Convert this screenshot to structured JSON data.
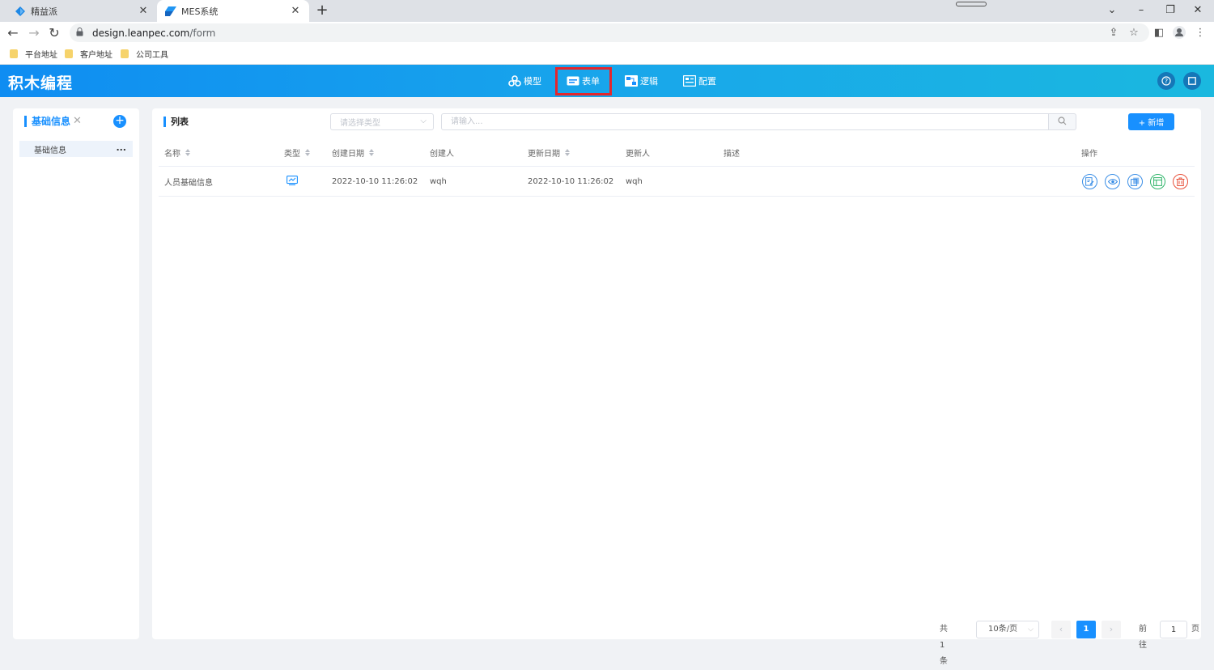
{
  "browser": {
    "tabs": [
      {
        "title": "精益派",
        "favicon": "diamond-icon",
        "active": false
      },
      {
        "title": "MES系统",
        "favicon": "diamond-icon",
        "active": true
      }
    ],
    "url_host": "design.leanpec.com",
    "url_path": "/form",
    "bookmarks": [
      "平台地址",
      "客户地址",
      "公司工具"
    ]
  },
  "app": {
    "logo": "积木编程",
    "nav": [
      {
        "label": "模型",
        "icon": "model-icon"
      },
      {
        "label": "表单",
        "icon": "form-icon",
        "active": true
      },
      {
        "label": "逻辑",
        "icon": "logic-icon"
      },
      {
        "label": "配置",
        "icon": "config-icon"
      }
    ],
    "header_icons": [
      "help-icon",
      "fullscreen-icon"
    ],
    "accent": "#1890ff",
    "highlight": "#e4262c"
  },
  "sidebar": {
    "title": "基础信息",
    "items": [
      {
        "label": "基础信息",
        "more": "..."
      }
    ]
  },
  "main": {
    "title": "列表",
    "type_select_placeholder": "请选择类型",
    "search_placeholder": "请输入...",
    "add_label": "+ 新增",
    "columns": [
      "名称",
      "类型",
      "创建日期",
      "创建人",
      "更新日期",
      "更新人",
      "描述",
      "操作"
    ],
    "rows": [
      {
        "name": "人员基础信息",
        "type_icon": "chart-icon",
        "created_at": "2022-10-10 11:26:02",
        "created_by": "wqh",
        "updated_at": "2022-10-10 11:26:02",
        "updated_by": "wqh",
        "description": "",
        "actions": [
          "edit-icon",
          "view-icon",
          "copy-icon",
          "layout-icon",
          "delete-icon"
        ]
      }
    ]
  },
  "pagination": {
    "total": "共 1 条",
    "page_size": "10条/页",
    "current_page": "1",
    "goto_label": "前往",
    "goto_value": "1",
    "page_suffix": "页"
  }
}
